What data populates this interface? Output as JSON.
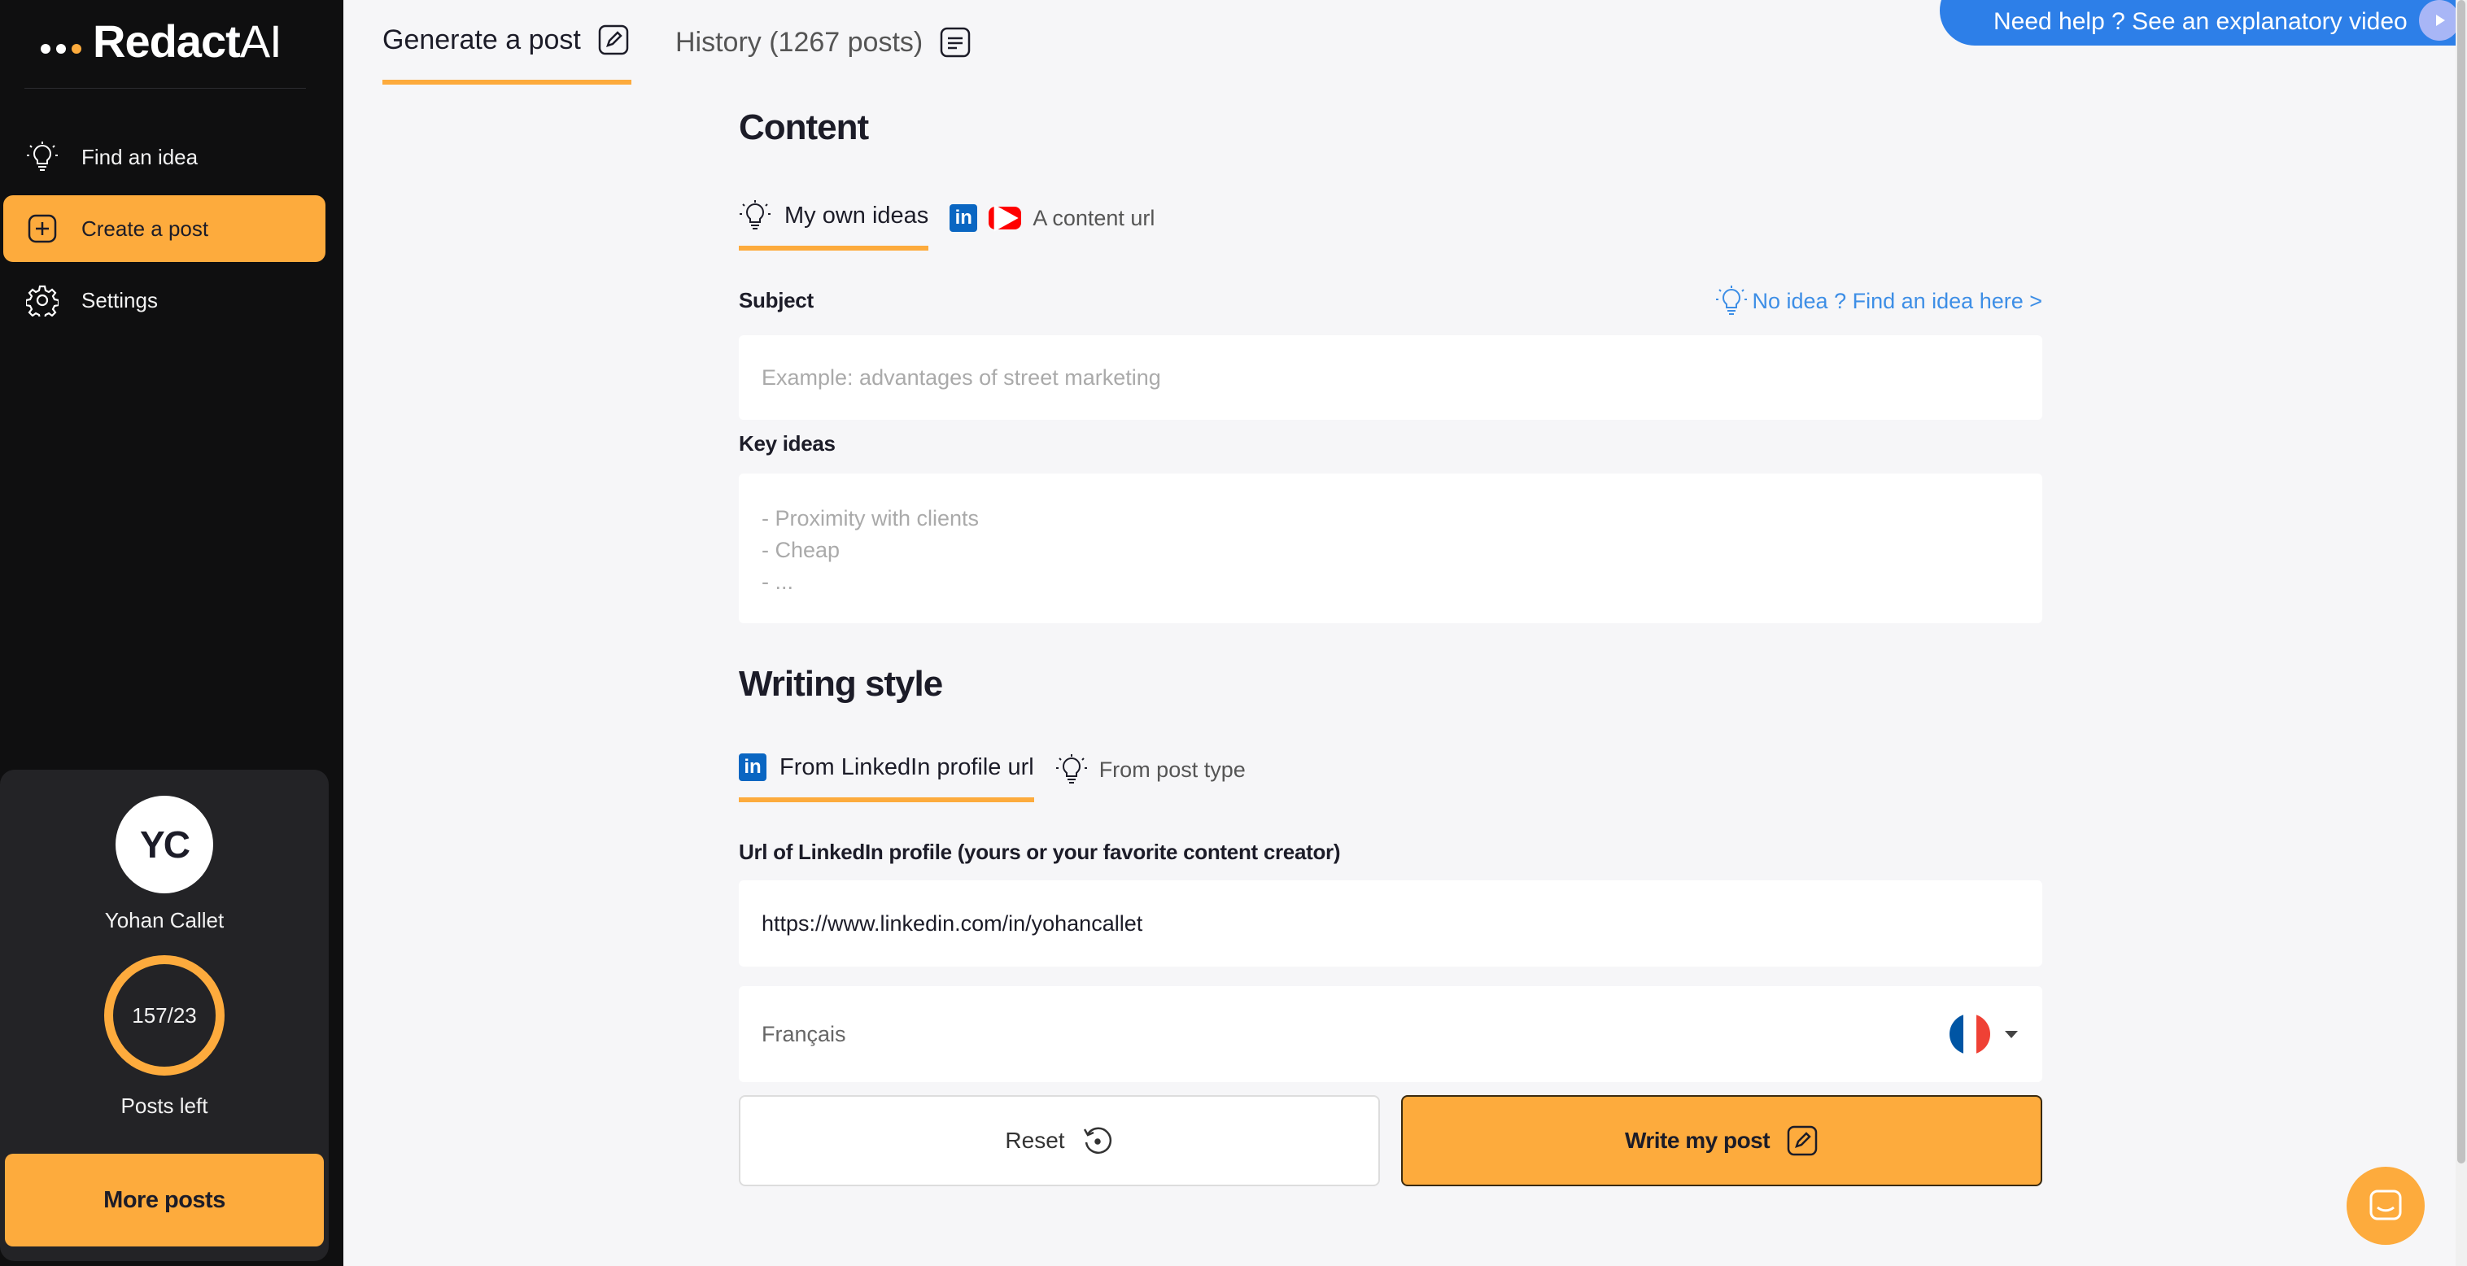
{
  "app": {
    "logo_main": "Redact",
    "logo_suffix": "AI",
    "brand_color": "#fdab3d",
    "link_color": "#3d8ee6",
    "help_color": "#2d7fe8"
  },
  "sidebar": {
    "nav": [
      {
        "label": "Find an idea",
        "icon": "lightbulb-icon"
      },
      {
        "label": "Create a post",
        "icon": "plus-square-icon",
        "active": true
      },
      {
        "label": "Settings",
        "icon": "gear-icon"
      }
    ],
    "user": {
      "initials": "YC",
      "name": "Yohan Callet",
      "counter": "157/23",
      "counter_caption": "Posts left",
      "more_button": "More posts"
    }
  },
  "top_tabs": {
    "generate": {
      "label": "Generate a post",
      "icon": "edit-icon",
      "active": true
    },
    "history": {
      "label": "History (1267 posts)",
      "icon": "list-icon"
    }
  },
  "help": {
    "label": "Need help ? See an explanatory video",
    "icon": "play-icon"
  },
  "content": {
    "title": "Content",
    "tabs": [
      {
        "label": "My own ideas",
        "icon": "lightbulb-icon",
        "active": true
      },
      {
        "label": "A content url",
        "icons": [
          "linkedin-icon",
          "youtube-icon"
        ]
      }
    ],
    "subject": {
      "label": "Subject",
      "placeholder": "Example: advantages of street marketing",
      "value": "",
      "idea_link": "No idea ? Find an idea here >"
    },
    "key_ideas": {
      "label": "Key ideas",
      "placeholder_lines": [
        "- Proximity with clients",
        "- Cheap",
        "- ..."
      ]
    }
  },
  "writing_style": {
    "title": "Writing style",
    "tabs": [
      {
        "label": "From LinkedIn profile url",
        "icon": "linkedin-icon",
        "active": true
      },
      {
        "label": "From post type",
        "icon": "lightbulb-icon"
      }
    ],
    "profile_url": {
      "label": "Url of LinkedIn profile (yours or your favorite content creator)",
      "value": "https://www.linkedin.com/in/yohancallet"
    },
    "language": {
      "selected": "Français",
      "flag": "fr-flag-icon"
    }
  },
  "actions": {
    "reset": "Reset",
    "write": "Write my post"
  }
}
